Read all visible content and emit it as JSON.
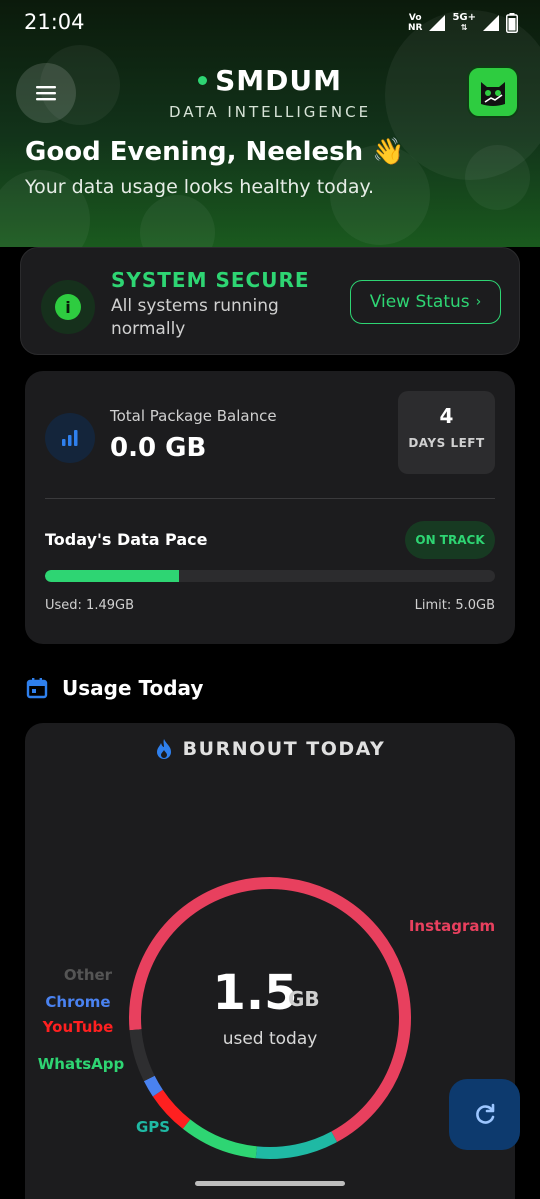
{
  "status_bar": {
    "time": "21:04",
    "volte": "Vo\nNR",
    "network": "5G+"
  },
  "header": {
    "brand_name": "SMDUM",
    "brand_sub": "DATA INTELLIGENCE",
    "greeting": "Good Evening, Neelesh 👋",
    "greeting_sub": "Your data usage looks healthy today."
  },
  "security": {
    "title": "SYSTEM SECURE",
    "subtitle": "All systems running normally",
    "button_label": "View Status",
    "button_chevron": "›"
  },
  "balance": {
    "label": "Total Package Balance",
    "value": "0.0 GB",
    "days_left_number": "4",
    "days_left_label": "DAYS LEFT",
    "pace_title": "Today's Data Pace",
    "pace_status": "ON TRACK",
    "used_label": "Used: 1.49GB",
    "limit_label": "Limit: 5.0GB",
    "progress_fraction": 0.298
  },
  "usage_section": {
    "title": "Usage Today"
  },
  "burnout": {
    "title": "BURNOUT TODAY",
    "total_value": "1.5",
    "total_unit": "GB",
    "total_caption": "used today"
  },
  "chart_data": {
    "type": "pie",
    "title": "BURNOUT TODAY",
    "center_label": "1.5 GB used today",
    "series": [
      {
        "name": "Instagram",
        "value": 68.5,
        "color": "#e8405e"
      },
      {
        "name": "GPS",
        "value": 9.5,
        "color": "#1fb9a4"
      },
      {
        "name": "WhatsApp",
        "value": 9.0,
        "color": "#2ed573"
      },
      {
        "name": "YouTube",
        "value": 5.0,
        "color": "#ff2020"
      },
      {
        "name": "Chrome",
        "value": 2.0,
        "color": "#4a82f0"
      },
      {
        "name": "Other",
        "value": 6.0,
        "color": "#2e2e30"
      }
    ]
  },
  "colors": {
    "accent": "#2ed573",
    "background": "#000000",
    "card": "#1c1c1e"
  },
  "icons": {
    "menu": "menu-icon",
    "logo": "app-logo-icon",
    "info": "info-icon",
    "signal_bars": "signal-bars-icon",
    "calendar": "calendar-icon",
    "fire": "fire-icon",
    "refresh": "refresh-icon"
  }
}
